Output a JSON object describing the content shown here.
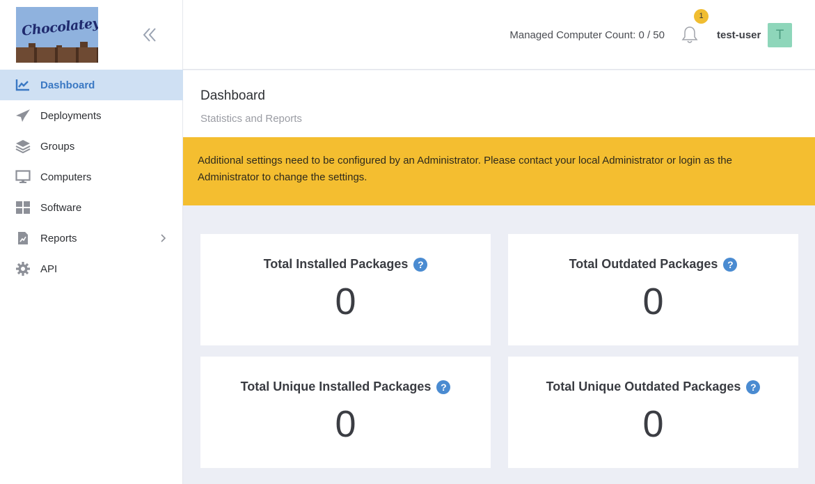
{
  "brand": {
    "logo_text": "Chocolatey"
  },
  "sidebar": {
    "items": [
      {
        "label": "Dashboard",
        "icon": "chart-line-icon",
        "active": true
      },
      {
        "label": "Deployments",
        "icon": "paper-plane-icon"
      },
      {
        "label": "Groups",
        "icon": "layers-icon"
      },
      {
        "label": "Computers",
        "icon": "desktop-icon"
      },
      {
        "label": "Software",
        "icon": "windows-icon"
      },
      {
        "label": "Reports",
        "icon": "file-chart-icon",
        "has_submenu": true
      },
      {
        "label": "API",
        "icon": "gear-icon"
      }
    ]
  },
  "header": {
    "managed_count": "Managed Computer Count: 0 / 50",
    "notification_count": "1",
    "username": "test-user",
    "avatar_initial": "T"
  },
  "page": {
    "title": "Dashboard",
    "subtitle": "Statistics and Reports"
  },
  "alert": {
    "text": "Additional settings need to be configured by an Administrator. Please contact your local Administrator or login as the Administrator to change the settings."
  },
  "cards": [
    {
      "title": "Total Installed Packages",
      "value": "0"
    },
    {
      "title": "Total Outdated Packages",
      "value": "0"
    },
    {
      "title": "Total Unique Installed Packages",
      "value": "0"
    },
    {
      "title": "Total Unique Outdated Packages",
      "value": "0"
    }
  ],
  "colors": {
    "accent": "#3a78c3",
    "active_bg": "#cfe0f3",
    "alert": "#f4be30",
    "badge": "#f0bd31",
    "avatar": "#8ed6ba",
    "help": "#4a8bd1"
  }
}
